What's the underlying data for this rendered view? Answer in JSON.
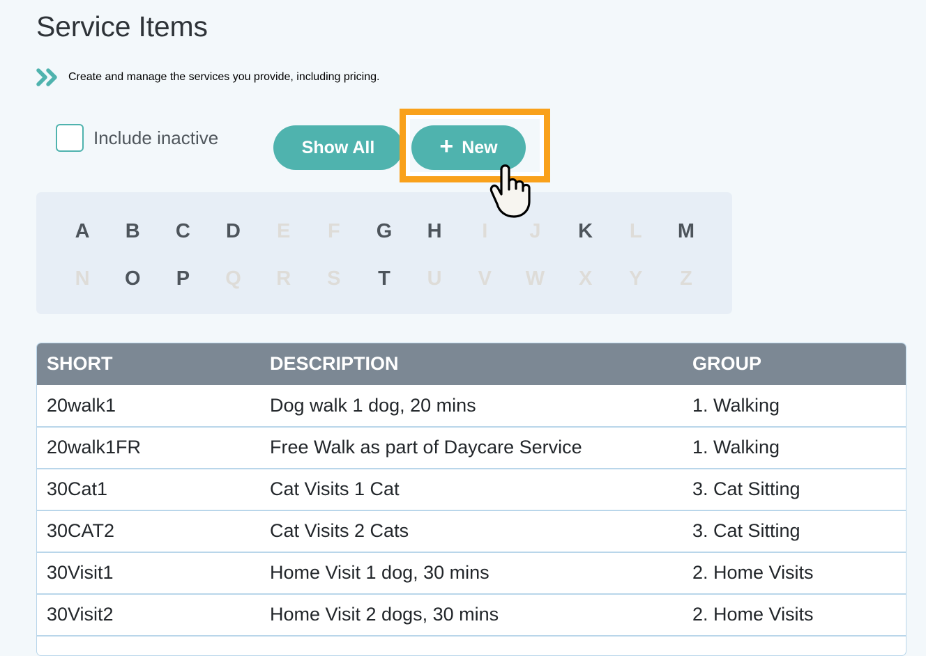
{
  "header": {
    "title": "Service Items",
    "subtitle": "Create and manage the services you provide, including pricing.",
    "subtitle_icon": "double-chevron-right-icon"
  },
  "controls": {
    "include_inactive_label": "Include inactive",
    "include_inactive_checked": false,
    "show_all_label": "Show All",
    "new_label": "New",
    "new_icon": "plus-icon",
    "highlight_color": "#f9a11b",
    "accent_color": "#4fb3ae"
  },
  "alphabet_filter": {
    "rows": [
      [
        {
          "letter": "A",
          "enabled": true
        },
        {
          "letter": "B",
          "enabled": true
        },
        {
          "letter": "C",
          "enabled": true
        },
        {
          "letter": "D",
          "enabled": true
        },
        {
          "letter": "E",
          "enabled": false
        },
        {
          "letter": "F",
          "enabled": false
        },
        {
          "letter": "G",
          "enabled": true
        },
        {
          "letter": "H",
          "enabled": true
        },
        {
          "letter": "I",
          "enabled": false
        },
        {
          "letter": "J",
          "enabled": false
        },
        {
          "letter": "K",
          "enabled": true
        },
        {
          "letter": "L",
          "enabled": false
        },
        {
          "letter": "M",
          "enabled": true
        }
      ],
      [
        {
          "letter": "N",
          "enabled": false
        },
        {
          "letter": "O",
          "enabled": true
        },
        {
          "letter": "P",
          "enabled": true
        },
        {
          "letter": "Q",
          "enabled": false
        },
        {
          "letter": "R",
          "enabled": false
        },
        {
          "letter": "S",
          "enabled": false
        },
        {
          "letter": "T",
          "enabled": true
        },
        {
          "letter": "U",
          "enabled": false
        },
        {
          "letter": "V",
          "enabled": false
        },
        {
          "letter": "W",
          "enabled": false
        },
        {
          "letter": "X",
          "enabled": false
        },
        {
          "letter": "Y",
          "enabled": false
        },
        {
          "letter": "Z",
          "enabled": false
        }
      ]
    ]
  },
  "table": {
    "columns": [
      "SHORT",
      "DESCRIPTION",
      "GROUP"
    ],
    "rows": [
      [
        "20walk1",
        "Dog walk 1 dog, 20 mins",
        "1. Walking"
      ],
      [
        "20walk1FR",
        "Free Walk as part of Daycare Service",
        "1. Walking"
      ],
      [
        "30Cat1",
        "Cat Visits 1 Cat",
        "3. Cat Sitting"
      ],
      [
        "30CAT2",
        "Cat Visits 2 Cats",
        "3. Cat Sitting"
      ],
      [
        "30Visit1",
        "Home Visit 1 dog, 30 mins",
        "2. Home Visits"
      ],
      [
        "30Visit2",
        "Home Visit 2 dogs, 30 mins",
        "2. Home Visits"
      ]
    ]
  }
}
